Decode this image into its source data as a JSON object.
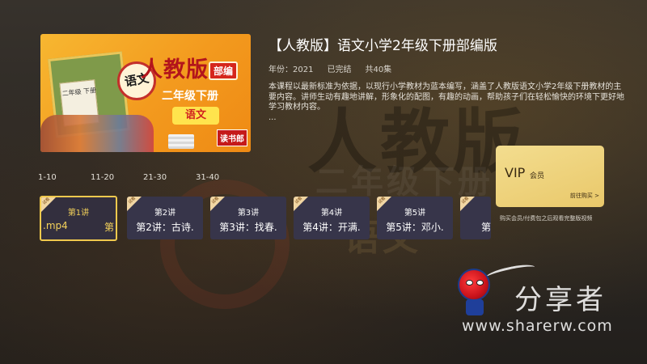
{
  "background": {
    "text_large": "人教版",
    "text_grade": "二年级下册",
    "text_subject": "语文"
  },
  "cover": {
    "title": "人教版",
    "badge": "部编",
    "grade": "二年级下册",
    "subject": "语文",
    "seal": "语文",
    "book_tag": "二年级 下册",
    "logo": "读书郎"
  },
  "course": {
    "title": "【人教版】语文小学2年级下册部编版",
    "year": "年份：2021",
    "status": "已完结",
    "episodes_total": "共40集",
    "description": "本课程以最新标准为依据，以现行小学教材为蓝本编写，涵盖了人教版语文小学2年级下册教材的主要内容。讲师生动有趣地讲解，形象化的配图，有趣的动画，帮助孩子们在轻松愉快的环境下更好地学习教材内容。",
    "ellipsis": "..."
  },
  "range_tabs": [
    "1-10",
    "11-20",
    "21-30",
    "31-40"
  ],
  "episodes": [
    {
      "title": "第1讲",
      "subtitle_left": ".mp4",
      "subtitle_right": "第",
      "corner": "试看"
    },
    {
      "title": "第2讲",
      "subtitle": "第2讲：古诗.",
      "corner": "试看"
    },
    {
      "title": "第3讲",
      "subtitle": "第3讲：找春.",
      "corner": "试看"
    },
    {
      "title": "第4讲",
      "subtitle": "第4讲：开满.",
      "corner": "试看"
    },
    {
      "title": "第5讲",
      "subtitle": "第5讲：邓小.",
      "corner": "试看"
    },
    {
      "title": "",
      "subtitle": "第",
      "corner": "试看"
    }
  ],
  "vip": {
    "big": "VIP",
    "small": "会员",
    "buy": "前往购买 >",
    "note": "购买会员/付费包之后观看完整版视频"
  },
  "watermark": {
    "text_cn": "分享者",
    "url": "www.sharerw.com"
  },
  "colors": {
    "accent_gold": "#f0c94d",
    "vip_card": "#f3dd8f",
    "episode_bg": "#37354a"
  }
}
